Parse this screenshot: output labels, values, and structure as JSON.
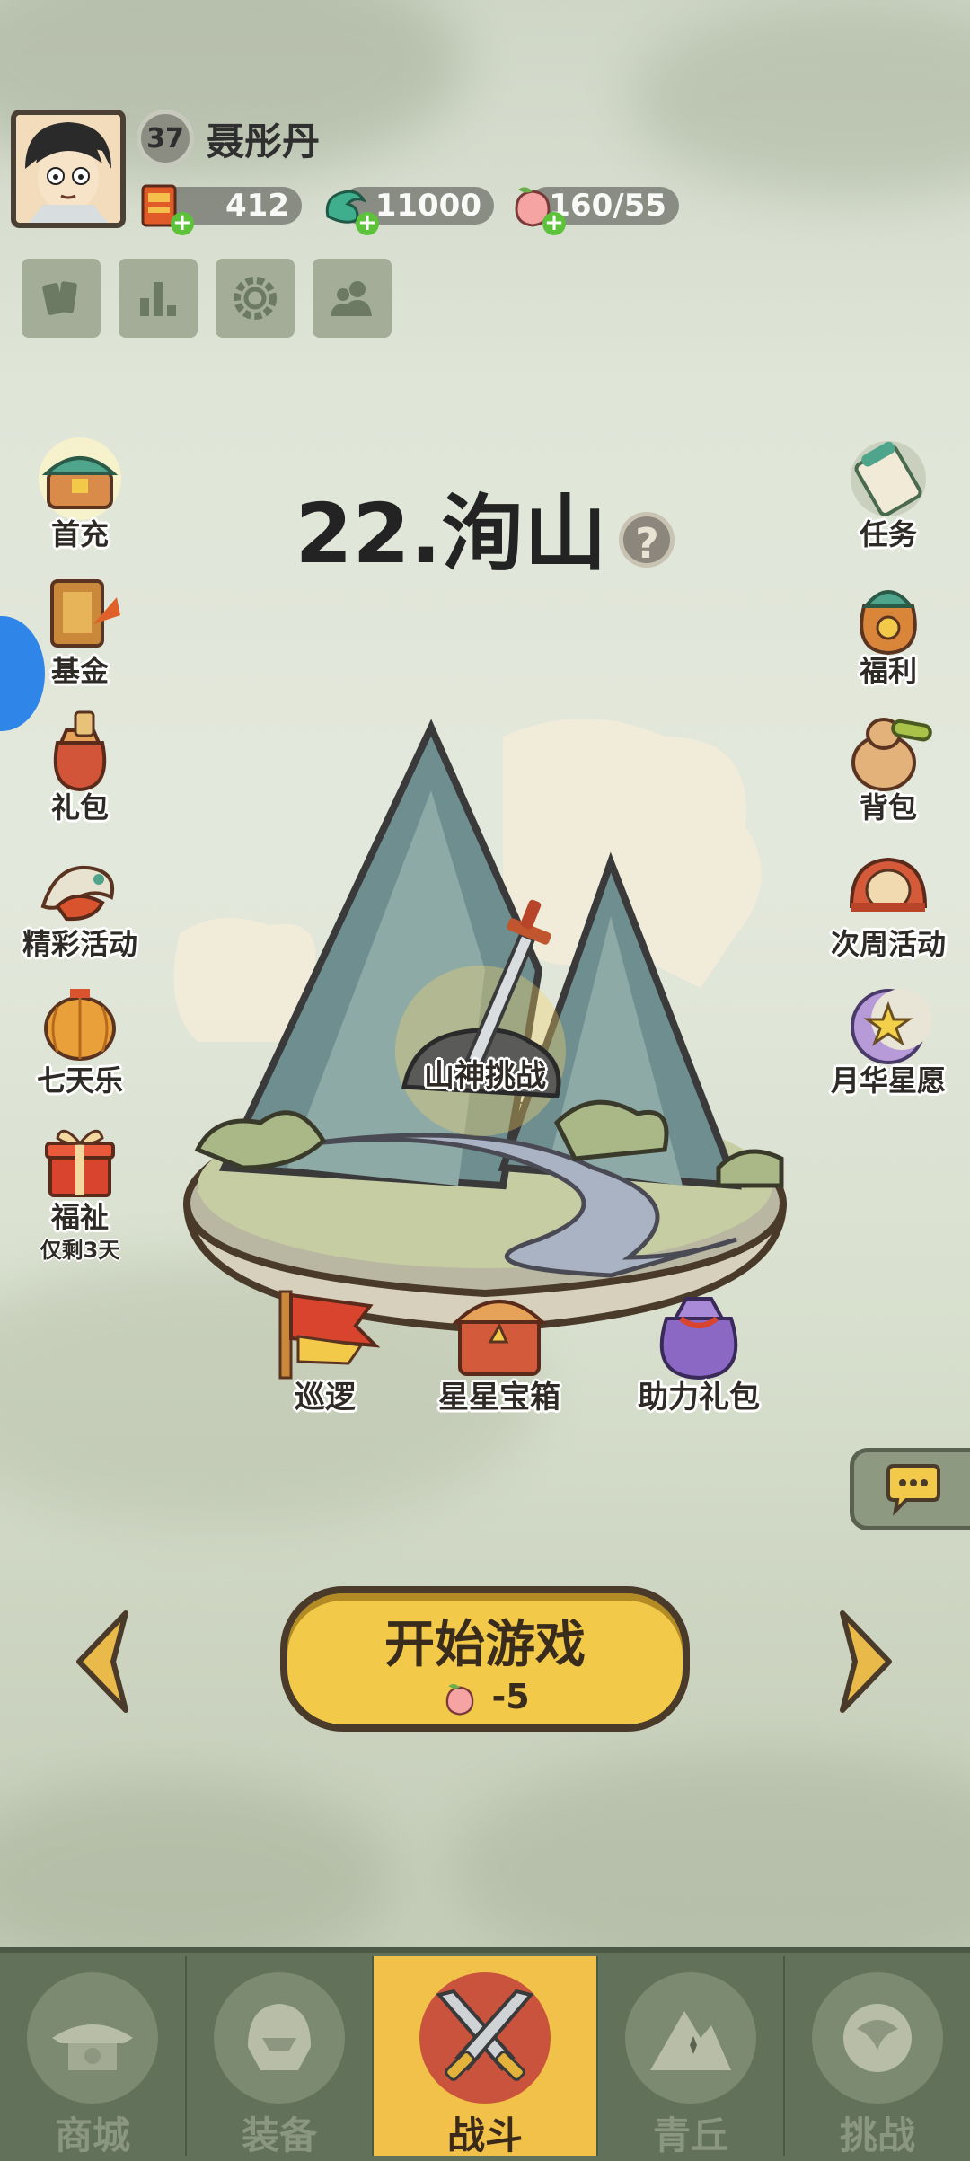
{
  "player": {
    "level": "37",
    "name": "聂彤丹"
  },
  "resources": [
    {
      "icon": "scroll-coupon-icon",
      "value": "412"
    },
    {
      "icon": "jade-dragon-icon",
      "value": "11000"
    },
    {
      "icon": "peach-stamina-icon",
      "value": "160/55"
    }
  ],
  "top_buttons": [
    "cards-icon",
    "ranking-icon",
    "settings-gear-icon",
    "friends-icon"
  ],
  "left_menu": [
    {
      "label": "首充",
      "icon": "treasure-chest-icon"
    },
    {
      "label": "基金",
      "icon": "fund-book-icon"
    },
    {
      "label": "礼包",
      "icon": "gift-pouch-icon"
    },
    {
      "label": "精彩活动",
      "icon": "dragon-event-icon"
    },
    {
      "label": "七天乐",
      "icon": "lantern-icon"
    },
    {
      "label": "福祉",
      "icon": "gift-box-icon",
      "sub": "仅剩3天"
    }
  ],
  "right_menu": [
    {
      "label": "任务",
      "icon": "quest-scroll-icon"
    },
    {
      "label": "福利",
      "icon": "welfare-bag-icon"
    },
    {
      "label": "背包",
      "icon": "backpack-gourd-icon"
    },
    {
      "label": "次周活动",
      "icon": "drum-event-icon"
    },
    {
      "label": "月华星愿",
      "icon": "moon-star-icon"
    }
  ],
  "stage": {
    "title": "22.洵山",
    "challenge_label": "山神挑战"
  },
  "stage_items": [
    {
      "label": "巡逻",
      "icon": "patrol-flag-icon"
    },
    {
      "label": "星星宝箱",
      "icon": "star-chest-icon"
    },
    {
      "label": "助力礼包",
      "icon": "support-pouch-icon"
    }
  ],
  "start": {
    "label": "开始游戏",
    "cost": "-5"
  },
  "bottom_tabs": [
    {
      "label": "商城",
      "active": false
    },
    {
      "label": "装备",
      "active": false
    },
    {
      "label": "战斗",
      "active": true
    },
    {
      "label": "青丘",
      "active": false
    },
    {
      "label": "挑战",
      "active": false
    }
  ],
  "colors": {
    "accent": "#f2c14a",
    "tab_bar": "#62725a",
    "plus": "#5cc23a"
  }
}
